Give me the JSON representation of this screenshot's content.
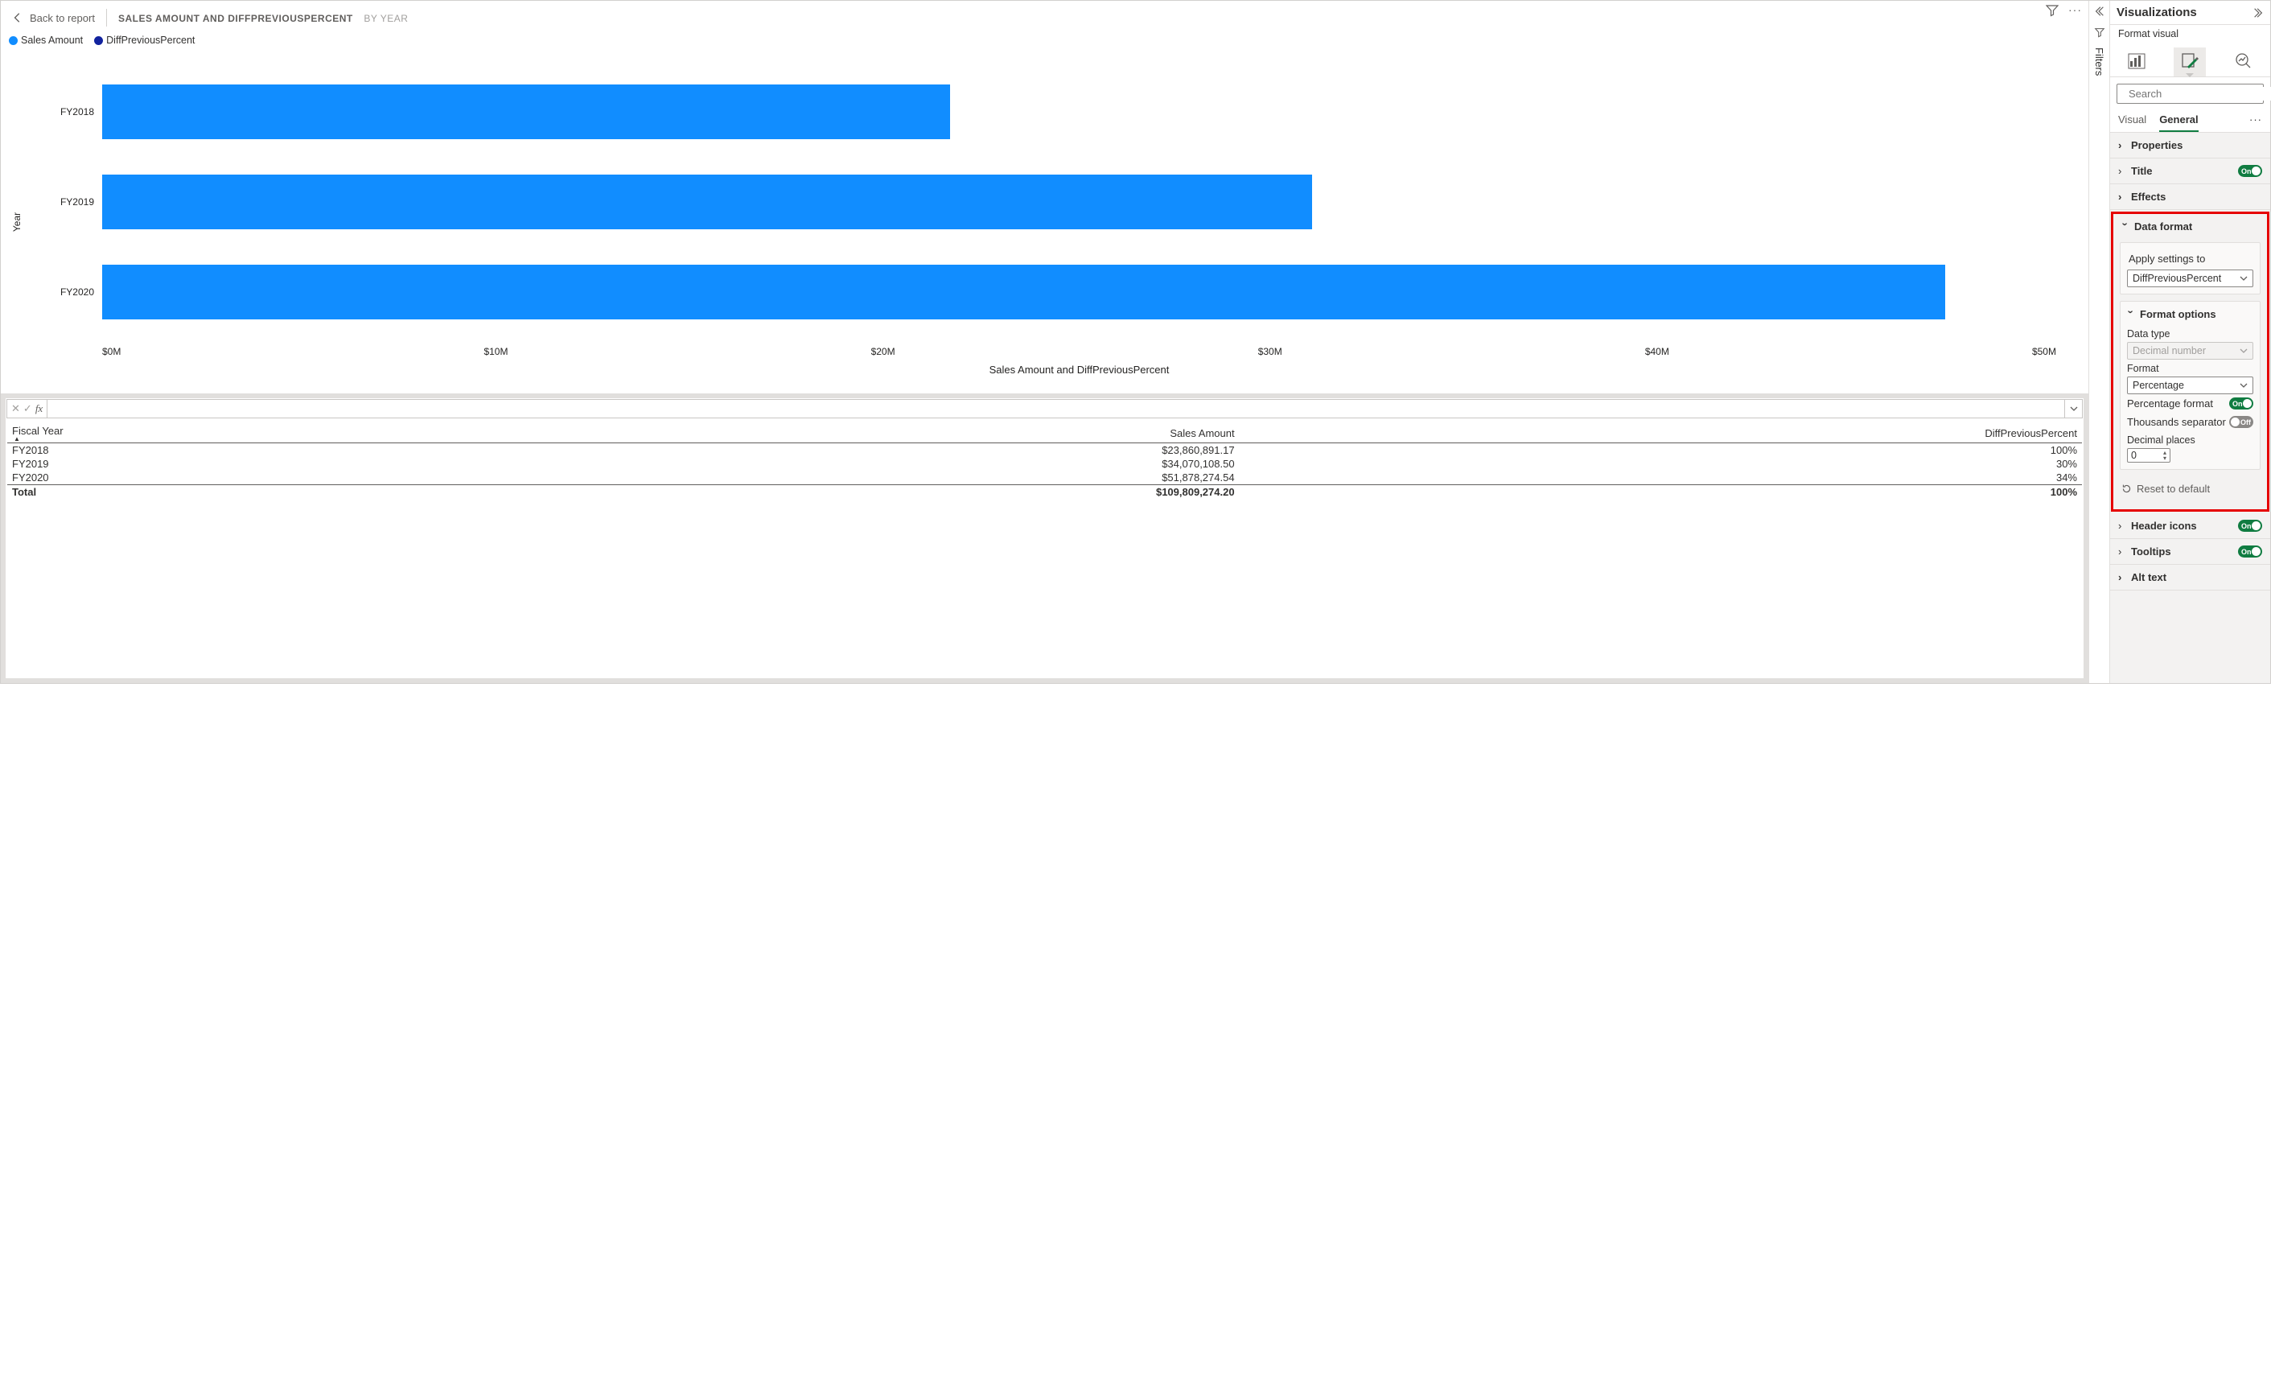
{
  "header": {
    "back": "Back to report",
    "title_main": "SALES AMOUNT AND DIFFPREVIOUSPERCENT",
    "title_by": "BY YEAR"
  },
  "legend": {
    "items": [
      {
        "label": "Sales Amount",
        "color": "#118dff"
      },
      {
        "label": "DiffPreviousPercent",
        "color": "#12239e"
      }
    ]
  },
  "chart_data": {
    "type": "bar",
    "orientation": "horizontal",
    "categories": [
      "FY2018",
      "FY2019",
      "FY2020"
    ],
    "series": [
      {
        "name": "Sales Amount",
        "values": [
          23860891.17,
          34070108.5,
          51878274.54
        ]
      }
    ],
    "title": "Sales Amount and DiffPreviousPercent",
    "xlabel": "Sales Amount and DiffPreviousPercent",
    "ylabel": "Year",
    "xlim": [
      0,
      55000000
    ],
    "x_tick_labels": [
      "$0M",
      "$10M",
      "$20M",
      "$30M",
      "$40M",
      "$50M"
    ]
  },
  "table": {
    "headers": [
      "Fiscal Year",
      "Sales Amount",
      "DiffPreviousPercent"
    ],
    "rows": [
      {
        "c0": "FY2018",
        "c1": "$23,860,891.17",
        "c2": "100%"
      },
      {
        "c0": "FY2019",
        "c1": "$34,070,108.50",
        "c2": "30%"
      },
      {
        "c0": "FY2020",
        "c1": "$51,878,274.54",
        "c2": "34%"
      }
    ],
    "total": {
      "c0": "Total",
      "c1": "$109,809,274.20",
      "c2": "100%"
    }
  },
  "filters_strip": {
    "label": "Filters"
  },
  "viz": {
    "title": "Visualizations",
    "subtitle": "Format visual",
    "search_placeholder": "Search",
    "tabs": {
      "visual": "Visual",
      "general": "General"
    },
    "sections": {
      "properties": "Properties",
      "title_s": "Title",
      "effects": "Effects",
      "data_format": "Data format",
      "header_icons": "Header icons",
      "tooltips": "Tooltips",
      "alt_text": "Alt text"
    },
    "data_format": {
      "apply_label": "Apply settings to",
      "apply_value": "DiffPreviousPercent",
      "format_options": "Format options",
      "data_type_label": "Data type",
      "data_type_value": "Decimal number",
      "format_label": "Format",
      "format_value": "Percentage",
      "pct_format_label": "Percentage format",
      "thousands_label": "Thousands separator",
      "decimal_label": "Decimal places",
      "decimal_value": "0",
      "reset": "Reset to default"
    },
    "toggle_on": "On",
    "toggle_off": "Off"
  }
}
